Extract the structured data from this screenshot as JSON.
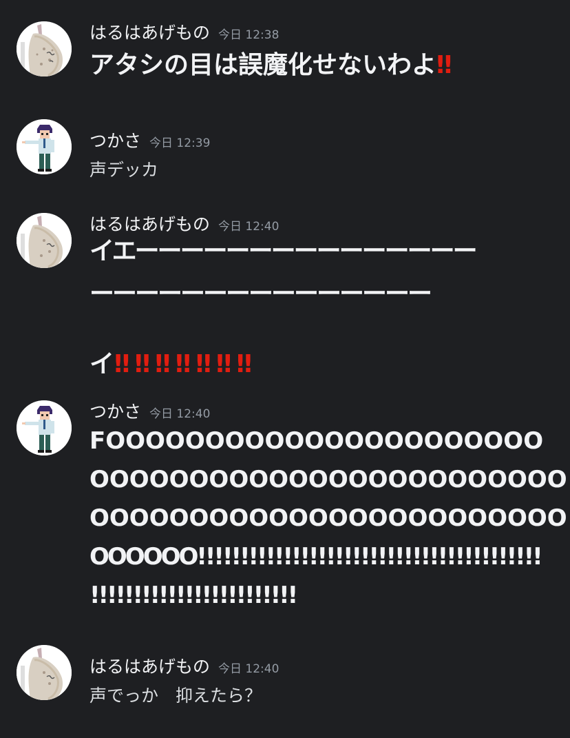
{
  "colors": {
    "background": "#1e1f22",
    "username": "#f2f3f5",
    "timestamp": "#949ba4",
    "text": "#dbdee1",
    "emoji_red": "#e11d10"
  },
  "messages": [
    {
      "username": "はるはあげもの",
      "timestamp": "今日 12:38",
      "avatar": "fried-shrimp-avatar",
      "text_main": "アタシの目は誤魔化せないわよ",
      "text_emoji": "‼"
    },
    {
      "username": "つかさ",
      "timestamp": "今日 12:39",
      "avatar": "pointing-boy-avatar",
      "text": "声デッカ"
    },
    {
      "username": "はるはあげもの",
      "timestamp": "今日 12:40",
      "avatar": "fried-shrimp-avatar",
      "line1": "イエーーーーーーーーーーーーーーー",
      "line2": "ーーーーーーーーーーーーーーー",
      "line3": "イ",
      "emojis": [
        "‼",
        "‼",
        "‼",
        "‼",
        "‼",
        "‼",
        "‼"
      ]
    },
    {
      "username": "つかさ",
      "timestamp": "今日 12:40",
      "avatar": "pointing-boy-avatar",
      "line1": "FOOOOOOOOOOOOOOOOOOOOOO",
      "line2": "OOOOOOOOOOOOOOOOOOOOOOOO",
      "line3": "OOOOOOOOOOOOOOOOOOOOOOOO",
      "line4": "OOOOOO!!!!!!!!!!!!!!!!!!!!!!!!!!!!!!!!!!!!!!!!",
      "line5": "!!!!!!!!!!!!!!!!!!!!!!!!"
    },
    {
      "username": "はるはあげもの",
      "timestamp": "今日 12:40",
      "avatar": "fried-shrimp-avatar",
      "text": "声でっか　抑えたら？"
    }
  ]
}
